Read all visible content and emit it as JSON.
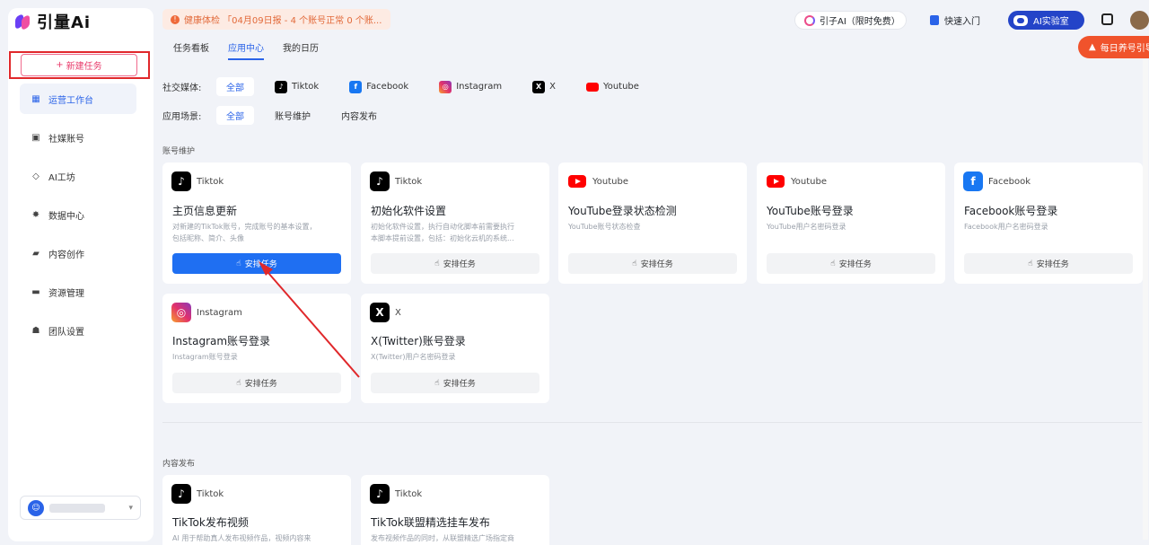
{
  "app": {
    "logo_text": "引量Ai"
  },
  "sidebar": {
    "new_task_label": "新建任务",
    "items": [
      {
        "label": "运营工作台",
        "icon": "dashboard-icon"
      },
      {
        "label": "社媒账号",
        "icon": "account-icon"
      },
      {
        "label": "AI工坊",
        "icon": "ai-workshop-icon"
      },
      {
        "label": "数据中心",
        "icon": "data-icon"
      },
      {
        "label": "内容创作",
        "icon": "folder-icon"
      },
      {
        "label": "资源管理",
        "icon": "resource-icon"
      },
      {
        "label": "团队设置",
        "icon": "team-icon"
      }
    ]
  },
  "header": {
    "notice": "健康体检 「04月09日报 - 4 个账号正常 0 个账...",
    "ai_pill": "引子AI（限时免费）",
    "quick_start": "快速入门",
    "ai_lab": "AI实验室",
    "daily_float": "每日养号引导"
  },
  "tabs": [
    "任务看板",
    "应用中心",
    "我的日历"
  ],
  "filters": {
    "social_label": "社交媒体:",
    "social": [
      "全部",
      "Tiktok",
      "Facebook",
      "Instagram",
      "X",
      "Youtube"
    ],
    "scene_label": "应用场景:",
    "scene": [
      "全部",
      "账号维护",
      "内容发布"
    ]
  },
  "sections": {
    "maintenance": "账号维护",
    "publish": "内容发布"
  },
  "cards": [
    {
      "platform": "Tiktok",
      "title": "主页信息更新",
      "desc": "对新建的TikTok账号，完成账号的基本设置，\n包括昵称、简介、头像",
      "btn": "安排任务"
    },
    {
      "platform": "Tiktok",
      "title": "初始化软件设置",
      "desc": "初始化软件设置，执行自动化脚本前需要执行\n本脚本提前设置，包括：初始化云机的系统...",
      "btn": "安排任务"
    },
    {
      "platform": "Youtube",
      "title": "YouTube登录状态检测",
      "desc": "YouTube账号状态检查",
      "btn": "安排任务"
    },
    {
      "platform": "Youtube",
      "title": "YouTube账号登录",
      "desc": "YouTube用户名密码登录",
      "btn": "安排任务"
    },
    {
      "platform": "Facebook",
      "title": "Facebook账号登录",
      "desc": "Facebook用户名密码登录",
      "btn": "安排任务"
    },
    {
      "platform": "Instagram",
      "title": "Instagram账号登录",
      "desc": "Instagram账号登录",
      "btn": "安排任务"
    },
    {
      "platform": "X",
      "title": "X(Twitter)账号登录",
      "desc": "X(Twitter)用户名密码登录",
      "btn": "安排任务"
    },
    {
      "platform": "Tiktok",
      "title": "TikTok发布视频",
      "desc": "AI 用于帮助真人发布视频作品，视频内容来",
      "btn": ""
    },
    {
      "platform": "Tiktok",
      "title": "TikTok联盟精选挂车发布",
      "desc": "发布视频作品的同时，从联盟精选广场指定商",
      "btn": ""
    }
  ],
  "colors": {
    "accent": "#2a63e8",
    "highlight_box": "#e0282b",
    "annotation_arrow": "#e0282b"
  }
}
